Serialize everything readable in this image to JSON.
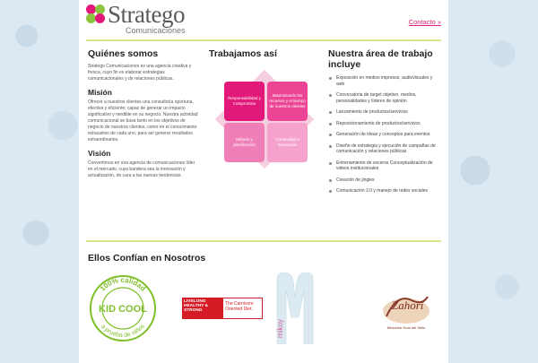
{
  "header": {
    "logo_text": "Stratego",
    "logo_sub": "Comunicaciones",
    "contact_link": "Contacto »"
  },
  "about": {
    "title": "Quiénes somos",
    "text": "Stratego Comunicaciones es una agencia creativa y fresca, cuyo fin es elaborar estrategias comunicacionales y de relaciones públicas.",
    "mission_title": "Misión",
    "mission_text": "Ofrecer a nuestros clientes una consultoría oportuna, efectiva y eficiente; capaz de generar un impacto significativo y medible en su negocio. Nuestra actividad comunicacional se basa tanto en los objetivos de negocio de nuestros clientes, como en el conocimiento exhaustivo de cada uno, para así generar resultados extraordinarios.",
    "vision_title": "Visión",
    "vision_text": "Convertirnos en una agencia de comunicaciones líder en el mercado, cuya bandera sea la innovación y actualización, de cara a las nuevas tendencias."
  },
  "workflow": {
    "title": "Trabajamos así",
    "boxes": [
      "Responsabilidad y Compromiso",
      "Maximizando los recursos y el tiempo de nuestros clientes",
      "Método y planificación",
      "Creatividad e Innovación"
    ]
  },
  "work_area": {
    "title": "Nuestra área de trabajo incluye",
    "items": [
      "Exposición en medios impresos, audiovisuales y web",
      "Convocatoria de target objetivo, medios, personalidades y líderes de opinión",
      "Lanzamiento de productos/servicios",
      "Reposicionamiento de productos/servicios",
      "Generación de ideas y conceptos para eventos",
      "Diseño de estrategia y ejecución de campañas de comunicación y relaciones públicas",
      "Entrenamiento de voceros Conceptualización de videos institucionales",
      "Creación de jingles",
      "Comunicación 2.0 y manejo de redes sociales"
    ]
  },
  "trust": {
    "title": "Ellos Confían en Nosotros",
    "kidcool_top": "100% calidad",
    "kidcool_name": "KID COOL",
    "kidcool_bottom": "a prueba de niños",
    "lh_left": "LIVELONG HEALTHY & STRONG",
    "lh_right": "The Carnivore Oriented Diet.",
    "mikoy": "mikoy",
    "zahori": "Zahorí",
    "zahori_sub": "Mesones Guía del Sello"
  },
  "colors": {
    "accent_pink": "#e3197a",
    "rule_green": "#d6e88a",
    "kidcool_green": "#7fbf2a"
  }
}
